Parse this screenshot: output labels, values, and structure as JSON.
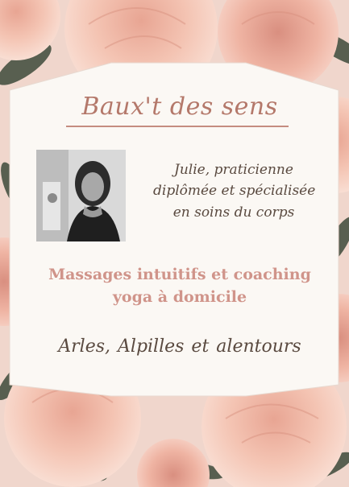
{
  "card": {
    "title": "Baux't des sens",
    "intro_lines": [
      "Julie, praticienne",
      "diplômée et spécialisée",
      "en soins du corps"
    ],
    "services_lines": [
      "Massages intuitifs et coaching",
      "yoga à domicile"
    ],
    "area": "Arles,  Alpilles et alentours"
  },
  "colors": {
    "title": "#b4786a",
    "services": "#d0948a",
    "body_text": "#5a4a40",
    "card": "#fbf8f4",
    "background_flowers": "#eebaa9"
  }
}
